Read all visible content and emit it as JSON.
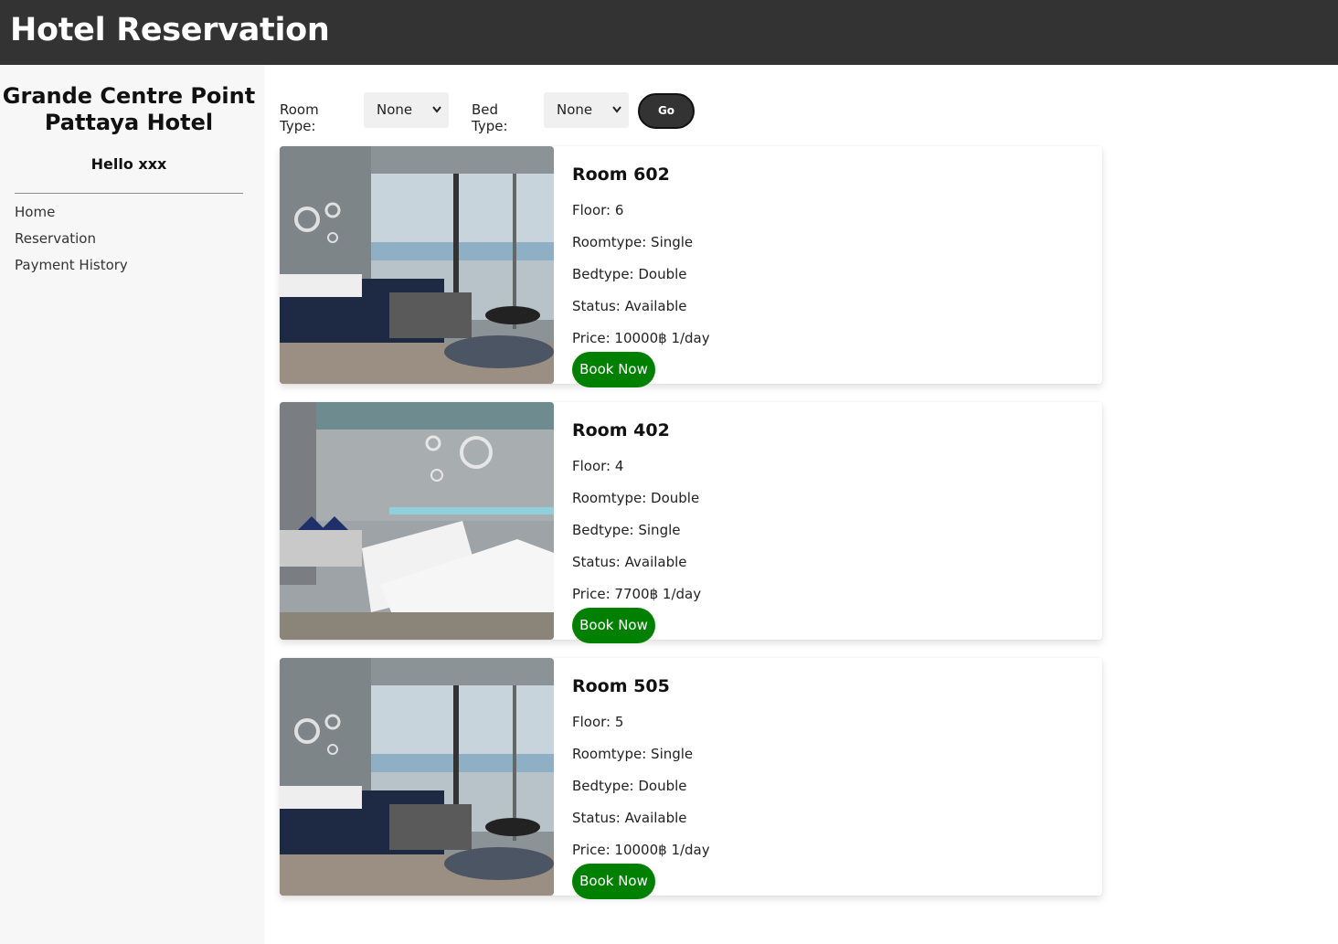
{
  "header": {
    "title": "Hotel Reservation"
  },
  "sidebar": {
    "hotel_name_line1": "Grande Centre Point",
    "hotel_name_line2": "Pattaya Hotel",
    "greeting": "Hello xxx",
    "nav": [
      "Home",
      "Reservation",
      "Payment History"
    ]
  },
  "filters": {
    "room_type_label": "Room Type:",
    "room_type_value": "None",
    "bed_type_label": "Bed Type:",
    "bed_type_value": "None",
    "go_label": "Go"
  },
  "rooms": [
    {
      "title": "Room 602",
      "floor": "Floor: 6",
      "roomtype": "Roomtype: Single",
      "bedtype": "Bedtype: Double",
      "status": "Status: Available",
      "price": "Price: 10000฿ 1/day",
      "book_label": "Book Now",
      "image": "room-photo-view"
    },
    {
      "title": "Room 402",
      "floor": "Floor: 4",
      "roomtype": "Roomtype: Double",
      "bedtype": "Bedtype: Single",
      "status": "Status: Available",
      "price": "Price: 7700฿ 1/day",
      "book_label": "Book Now",
      "image": "room-photo-twin"
    },
    {
      "title": "Room 505",
      "floor": "Floor: 5",
      "roomtype": "Roomtype: Single",
      "bedtype": "Bedtype: Double",
      "status": "Status: Available",
      "price": "Price: 10000฿ 1/day",
      "book_label": "Book Now",
      "image": "room-photo-view"
    }
  ],
  "colors": {
    "header_bg": "#333333",
    "sidebar_bg": "#f7f7f7",
    "book_button": "#008000",
    "go_button": "#333333"
  }
}
